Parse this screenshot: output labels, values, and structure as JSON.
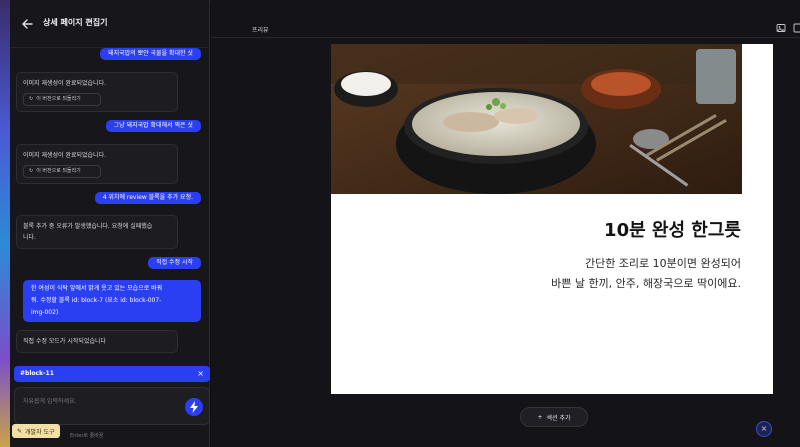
{
  "sidebar": {
    "title": "상세 페이지 편집기",
    "messages": [
      {
        "role": "user",
        "text": "돼지국밥의 뽀얀 국물을 확대한 샷"
      },
      {
        "role": "system",
        "text": "이미지 재생성이 완료되었습니다.",
        "revert": "이 버전으로 되돌리기"
      },
      {
        "role": "user",
        "text": "그냥 돼지국밥 확대해서 찍은 샷"
      },
      {
        "role": "system",
        "text": "이미지 재생성이 완료되었습니다.",
        "revert": "이 버전으로 되돌리기"
      },
      {
        "role": "user",
        "text": "4 위치에 review 블록을 추가 요청."
      },
      {
        "role": "system",
        "text_line1": "블록 추가 중 오류가 발생했습니다. 요청에 실패했습",
        "text_line2": "니다."
      },
      {
        "role": "user",
        "text": "직접 수정 시작"
      },
      {
        "role": "user",
        "text_line1": "한 여성이 식탁 앞에서 밝게 웃고 있는 모습으로 바꿔",
        "text_line2": "줘. 수정할 블록 id: block-7 (요소 id: block-007-",
        "text_line3": "img-002)"
      },
      {
        "role": "system",
        "text": "직접 수정 모드가 시작되었습니다"
      }
    ],
    "selected_tag": "#block-11",
    "input_placeholder": "자유롭게 입력하세요.",
    "hint": "Enter로 줄바꿈",
    "dev_tools": "개발자 도구"
  },
  "main": {
    "title": "프리뷰",
    "headline": "10분 완성 한그릇",
    "desc_line1": "간단한 조리로 10분이면 완성되어",
    "desc_line2": "바쁜 날 한끼, 안주, 해장국으로 딱이에요.",
    "add_section": "섹션 추가"
  },
  "colors": {
    "accent": "#2b3ff2",
    "sidebar_bg": "#17171b",
    "canvas_bg": "#ffffff"
  }
}
